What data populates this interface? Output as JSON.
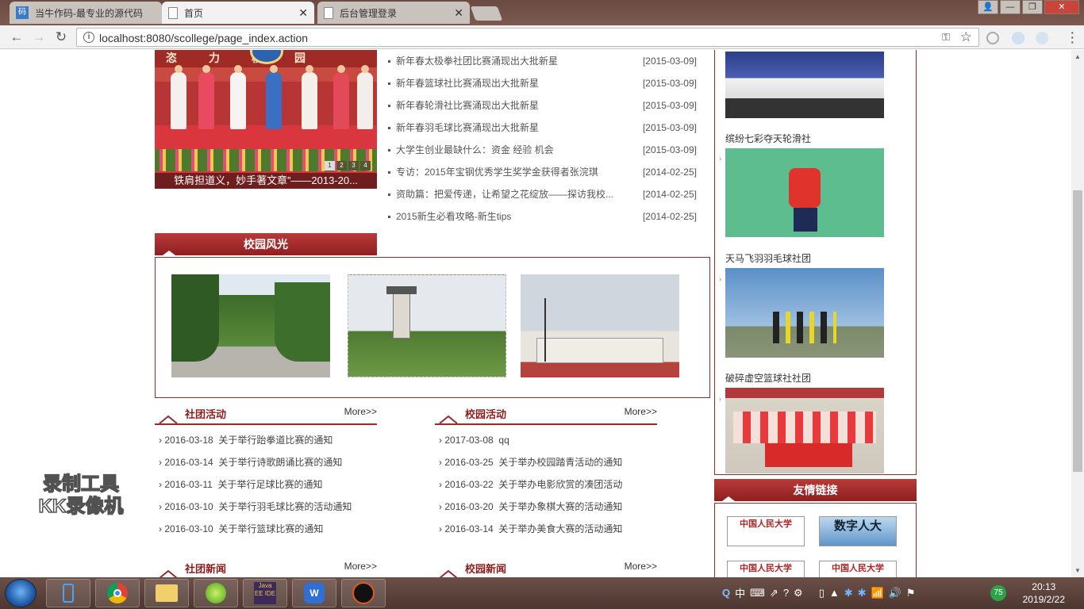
{
  "browser": {
    "tabs": [
      {
        "title": "当牛作码-最专业的源代码",
        "active": false
      },
      {
        "title": "首页",
        "active": true
      },
      {
        "title": "后台管理登录",
        "active": false
      }
    ],
    "url": "localhost:8080/scollege/page_index.action"
  },
  "slider": {
    "banner_text": "恣力校园",
    "caption": "铁肩担道义，妙手著文章”——2013-20...",
    "pages": [
      "1",
      "2",
      "3",
      "4"
    ]
  },
  "news": [
    {
      "title": "新年春太极拳社团比赛涌现出大批新星",
      "date": "[2015-03-09]"
    },
    {
      "title": "新年春篮球社比赛涌现出大批新星",
      "date": "[2015-03-09]"
    },
    {
      "title": "新年春轮滑社比赛涌现出大批新星",
      "date": "[2015-03-09]"
    },
    {
      "title": "新年春羽毛球比赛涌现出大批新星",
      "date": "[2015-03-09]"
    },
    {
      "title": "大学生创业最缺什么：资金 经验 机会",
      "date": "[2015-03-09]"
    },
    {
      "title": "专访：2015年宝钢优秀学生奖学金获得者张浣琪",
      "date": "[2014-02-25]"
    },
    {
      "title": "资助篇：把爱传递，让希望之花绽放——探访我校...",
      "date": "[2014-02-25]"
    },
    {
      "title": "2015新生必看攻略-新生tips",
      "date": "[2014-02-25]"
    }
  ],
  "campus": {
    "heading": "校园风光"
  },
  "club_activities": {
    "heading": "社团活动",
    "more": "More>>",
    "items": [
      {
        "date": "2016-03-18",
        "title": "关于举行跆拳道比赛的通知"
      },
      {
        "date": "2016-03-14",
        "title": "关于举行诗歌朗诵比赛的通知"
      },
      {
        "date": "2016-03-11",
        "title": "关于举行足球比赛的通知"
      },
      {
        "date": "2016-03-10",
        "title": "关于举行羽毛球比赛的活动通知"
      },
      {
        "date": "2016-03-10",
        "title": "关于举行篮球比赛的通知"
      }
    ]
  },
  "campus_activities": {
    "heading": "校园活动",
    "more": "More>>",
    "items": [
      {
        "date": "2017-03-08",
        "title": "qq"
      },
      {
        "date": "2016-03-25",
        "title": "关于举办校园踏青活动的通知"
      },
      {
        "date": "2016-03-22",
        "title": "关于举办电影欣赏的凑团活动"
      },
      {
        "date": "2016-03-20",
        "title": "关于举办象棋大赛的活动通知"
      },
      {
        "date": "2016-03-14",
        "title": "关于举办美食大赛的活动通知"
      }
    ]
  },
  "club_news": {
    "heading": "社团新闻",
    "more": "More>>"
  },
  "campus_news": {
    "heading": "校园新闻",
    "more": "More>>"
  },
  "clubs": [
    {
      "name": "缤纷七彩夺天轮滑社"
    },
    {
      "name": "天马飞羽羽毛球社团"
    },
    {
      "name": "破碎虚空篮球社社团"
    }
  ],
  "friend_links": {
    "heading": "友情链接",
    "logos": [
      "中国人民大学",
      "数字人大",
      "中国人民大学",
      "中国人民大学"
    ]
  },
  "watermark": {
    "line1": "录制工具",
    "line2": "KK录像机"
  },
  "taskbar": {
    "time": "20:13",
    "date": "2019/2/22",
    "tray_lang": "中",
    "badge": "75"
  },
  "colors": {
    "accent": "#9a2a2a",
    "header_red": "#b83a39"
  }
}
